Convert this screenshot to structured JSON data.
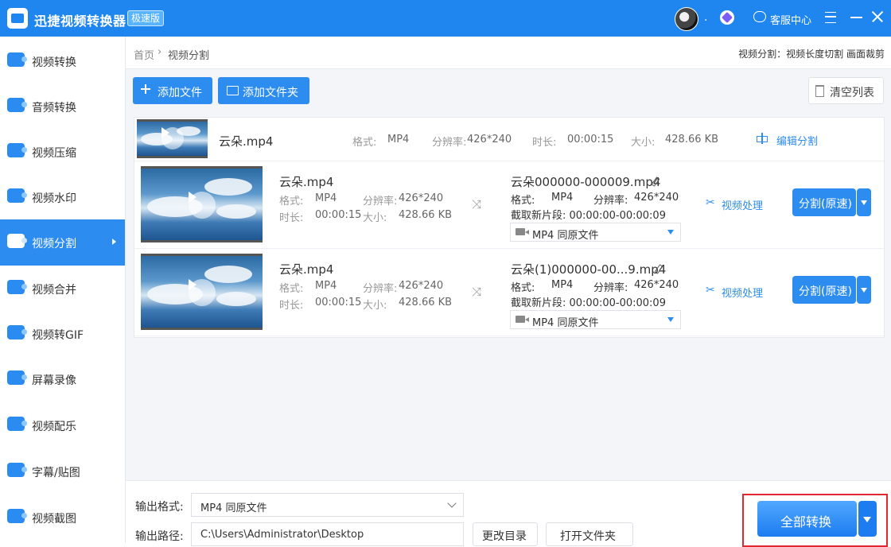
{
  "app": {
    "title": "迅捷视频转换器",
    "edition": "极速版",
    "avatar_dot": ".",
    "service_label": "客服中心"
  },
  "sidebar": {
    "items": [
      {
        "label": "视频转换"
      },
      {
        "label": "音频转换"
      },
      {
        "label": "视频压缩"
      },
      {
        "label": "视频水印"
      },
      {
        "label": "视频分割"
      },
      {
        "label": "视频合并"
      },
      {
        "label": "视频转GIF"
      },
      {
        "label": "屏幕录像"
      },
      {
        "label": "视频配乐"
      },
      {
        "label": "字幕/贴图"
      },
      {
        "label": "视频截图"
      }
    ],
    "active": "视频分割"
  },
  "breadcrumb": {
    "home": "首页",
    "separator": "›",
    "current": "视频分割",
    "right_info": "视频分割：视频长度切割 画面裁剪"
  },
  "toolbar": {
    "add_file": "添加文件",
    "add_folder": "添加文件夹",
    "clear_list": "清空列表"
  },
  "parent_file": {
    "name": "云朵.mp4",
    "format_label": "格式:",
    "format": "MP4",
    "resolution_label": "分辨率:",
    "resolution": "426*240",
    "duration_label": "时长:",
    "duration": "00:00:15",
    "size_label": "大小:",
    "size": "428.66 KB",
    "edit_split": "编辑分割"
  },
  "segments": [
    {
      "name": "云朵.mp4",
      "format_label": "格式:",
      "format": "MP4",
      "resolution_label": "分辨率:",
      "resolution": "426*240",
      "duration_label": "时长:",
      "duration": "00:00:15",
      "size_label": "大小:",
      "size": "428.66 KB",
      "output_name": "云朵000000-000009.mp4",
      "out_format_label": "格式:",
      "out_format": "MP4",
      "out_resolution_label": "分辨率:",
      "out_resolution": "426*240",
      "clip_range": "截取新片段: 00:00:00-00:00:09",
      "format_select": "MP4  同原文件",
      "process_label": "视频处理",
      "split_button": "分割(原速)"
    },
    {
      "name": "云朵.mp4",
      "format_label": "格式:",
      "format": "MP4",
      "resolution_label": "分辨率:",
      "resolution": "426*240",
      "duration_label": "时长:",
      "duration": "00:00:15",
      "size_label": "大小:",
      "size": "428.66 KB",
      "output_name": "云朵(1)000000-00...9.mp4",
      "out_format_label": "格式:",
      "out_format": "MP4",
      "out_resolution_label": "分辨率:",
      "out_resolution": "426*240",
      "clip_range": "截取新片段: 00:00:00-00:00:09",
      "format_select": "MP4  同原文件",
      "process_label": "视频处理",
      "split_button": "分割(原速)"
    }
  ],
  "bottom": {
    "output_format_label": "输出格式:",
    "output_format_value": "MP4  同原文件",
    "output_path_label": "输出路径:",
    "output_path_value": "C:\\Users\\Administrator\\Desktop",
    "change_dir": "更改目录",
    "open_folder": "打开文件夹",
    "convert_all": "全部转换"
  },
  "colors": {
    "accent": "#2d8cf0",
    "titlebar": "#1f86f0",
    "highlight": "#e3262f"
  },
  "icons": [
    "app-logo-icon",
    "vip-icon",
    "headset-icon",
    "menu-icon",
    "minimize-icon",
    "close-icon",
    "plus-icon",
    "folder-icon",
    "trash-icon",
    "play-icon",
    "edit-split-icon",
    "shuffle-icon",
    "pencil-icon",
    "video-icon",
    "scissors-icon",
    "chevron-down-icon",
    "caret-down-icon"
  ]
}
